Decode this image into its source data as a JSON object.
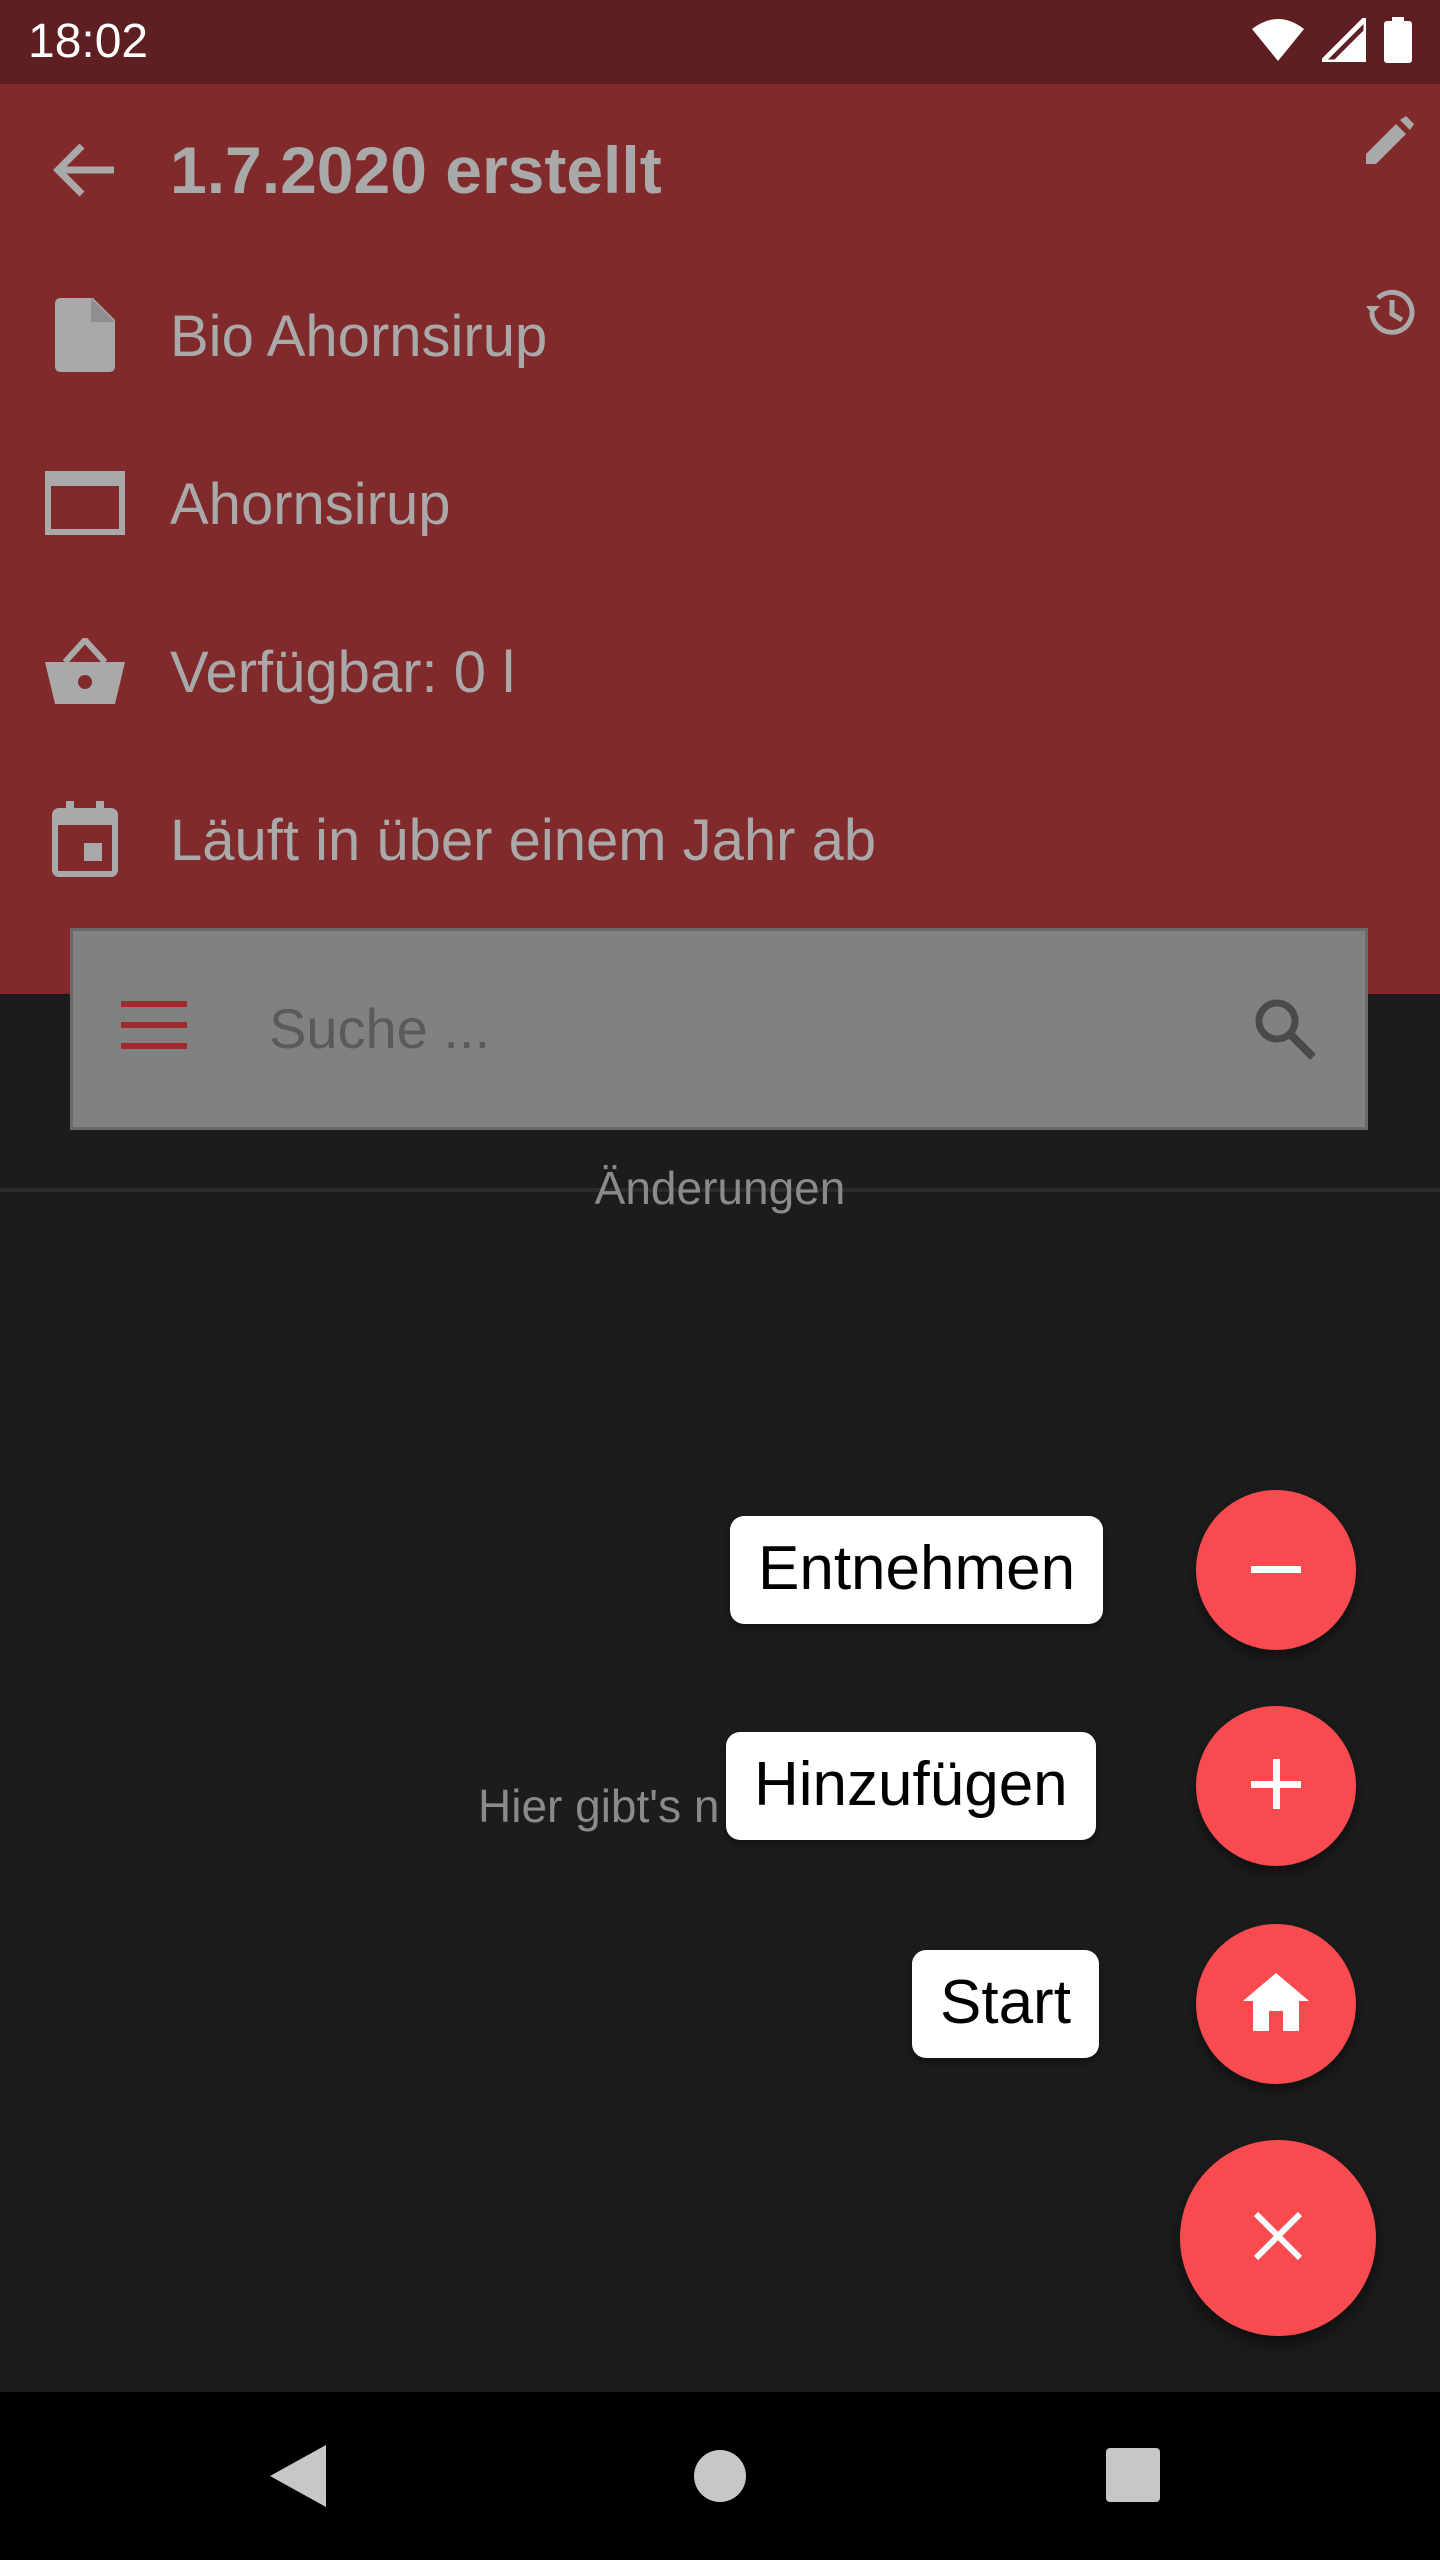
{
  "status_bar": {
    "time": "18:02",
    "icons": [
      "wifi-icon",
      "signal-icon",
      "battery-icon"
    ]
  },
  "header": {
    "title": "1.7.2020 erstellt",
    "back_icon": "arrow-back-icon",
    "edit_icon": "pencil-icon",
    "history_icon": "history-icon",
    "rows": [
      {
        "icon": "file-icon",
        "text": "Bio Ahornsirup"
      },
      {
        "icon": "folder-icon",
        "text": "Ahornsirup"
      },
      {
        "icon": "basket-icon",
        "text": "Verfügbar: 0 l"
      },
      {
        "icon": "calendar-icon",
        "text": "Läuft in über einem Jahr ab"
      }
    ]
  },
  "search": {
    "placeholder": "Suche ..."
  },
  "tabs": {
    "changes": "Änderungen"
  },
  "empty_state": "Hier gibt's n",
  "speed_dial": {
    "actions": [
      {
        "label": "Entnehmen",
        "icon": "minus-icon"
      },
      {
        "label": "Hinzufügen",
        "icon": "plus-icon"
      },
      {
        "label": "Start",
        "icon": "home-icon"
      }
    ],
    "main_icon": "close-icon"
  },
  "colors": {
    "header_bg": "#802a2c",
    "status_bg": "#5e1f22",
    "fab": "#f74b50",
    "background": "#1c1c1d"
  }
}
